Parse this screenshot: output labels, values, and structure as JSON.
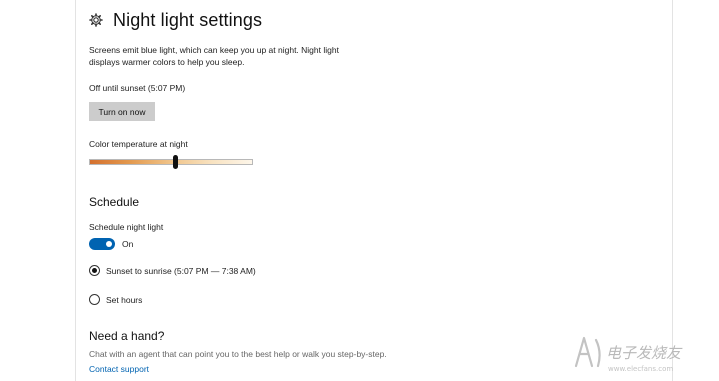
{
  "page": {
    "title": "Night light settings",
    "title_icon": "gear-icon",
    "description": "Screens emit blue light, which can keep you up at night. Night light displays warmer colors to help you sleep.",
    "status": "Off until sunset (5:07 PM)",
    "turn_on_button": "Turn on now",
    "color_temp_label": "Color temperature at night",
    "color_temp_level": 0.53
  },
  "schedule": {
    "heading": "Schedule",
    "toggle_label": "Schedule night light",
    "toggle_state": "On",
    "toggle_on": true,
    "options": [
      {
        "label": "Sunset to sunrise (5:07 PM — 7:38 AM)",
        "selected": true
      },
      {
        "label": "Set hours",
        "selected": false
      }
    ]
  },
  "help": {
    "heading": "Need a hand?",
    "description": "Chat with an agent that can point you to the best help or walk you step-by-step.",
    "link": "Contact support"
  },
  "watermark": {
    "text": "电子发烧友",
    "url": "www.elecfans.com"
  },
  "colors": {
    "accent": "#0063b1",
    "button_bg": "#cccccc",
    "slider_warm": "#d4702e",
    "slider_cool": "#fdf6ea"
  }
}
